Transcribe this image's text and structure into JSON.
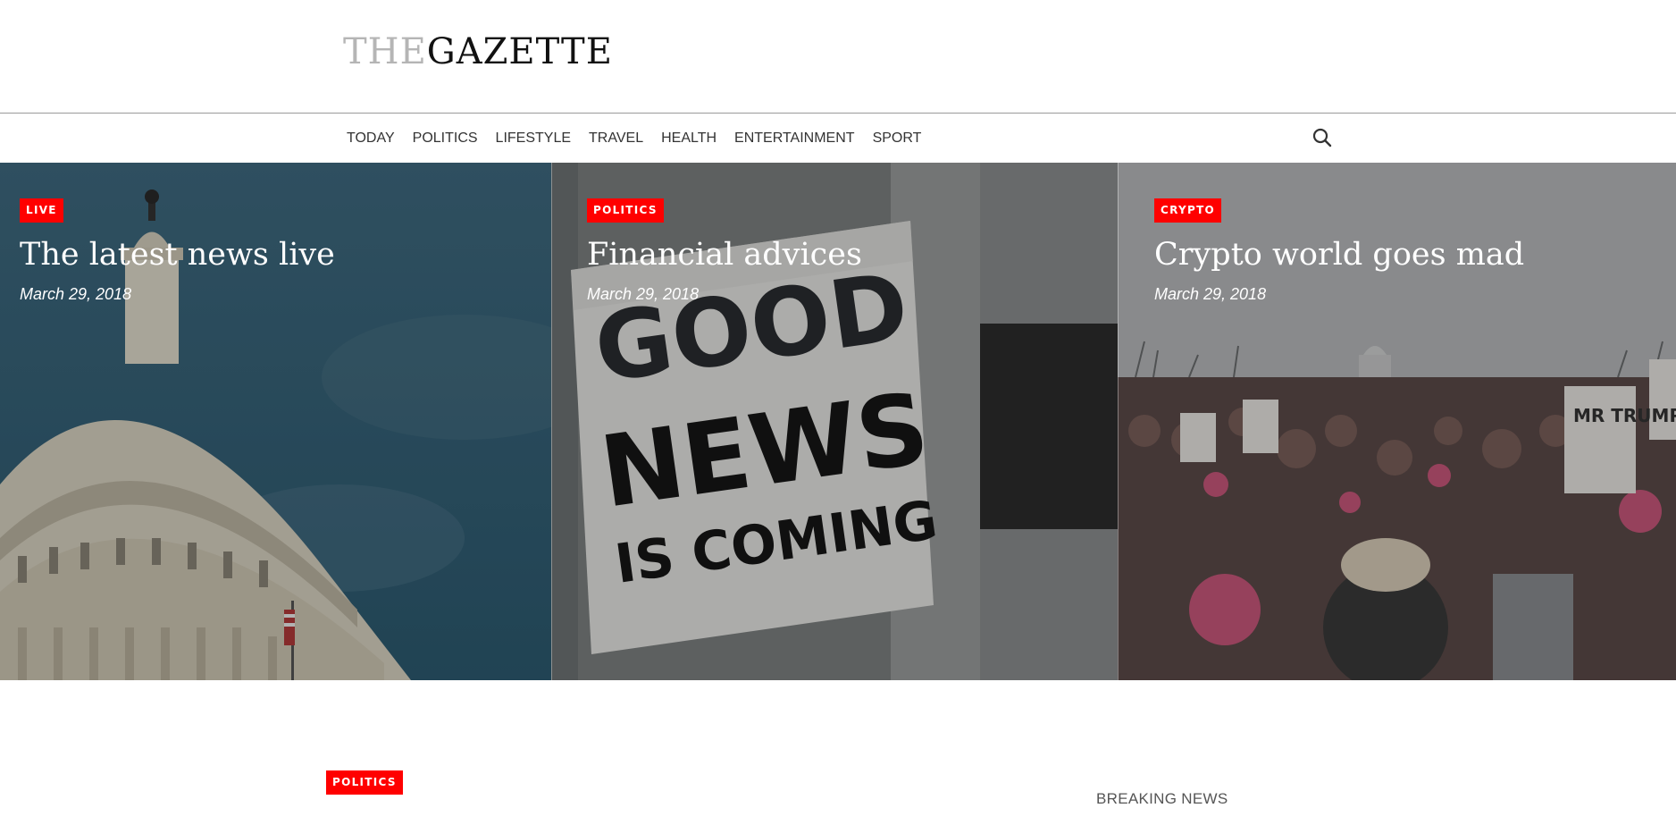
{
  "site": {
    "logo_the": "THE",
    "logo_gazette": "GAZETTE"
  },
  "nav": {
    "items": [
      {
        "label": "TODAY"
      },
      {
        "label": "POLITICS"
      },
      {
        "label": "LIFESTYLE"
      },
      {
        "label": "TRAVEL"
      },
      {
        "label": "HEALTH"
      },
      {
        "label": "ENTERTAINMENT"
      },
      {
        "label": "SPORT"
      }
    ],
    "search_icon": "search-icon"
  },
  "hero": {
    "cards": [
      {
        "badge": "LIVE",
        "title": "The latest news live",
        "date": "March 29, 2018",
        "image": "capitol-dome"
      },
      {
        "badge": "POLITICS",
        "title": "Financial advices",
        "date": "March 29, 2018",
        "image": "good-news-poster"
      },
      {
        "badge": "CRYPTO",
        "title": "Crypto world goes mad",
        "date": "March 29, 2018",
        "image": "protest-crowd"
      }
    ]
  },
  "section": {
    "badge": "POLITICS",
    "breaking_label": "BREAKING NEWS"
  },
  "colors": {
    "badge": "#ff0000",
    "logo_light": "#b5b5b5",
    "logo_dark": "#111111"
  }
}
